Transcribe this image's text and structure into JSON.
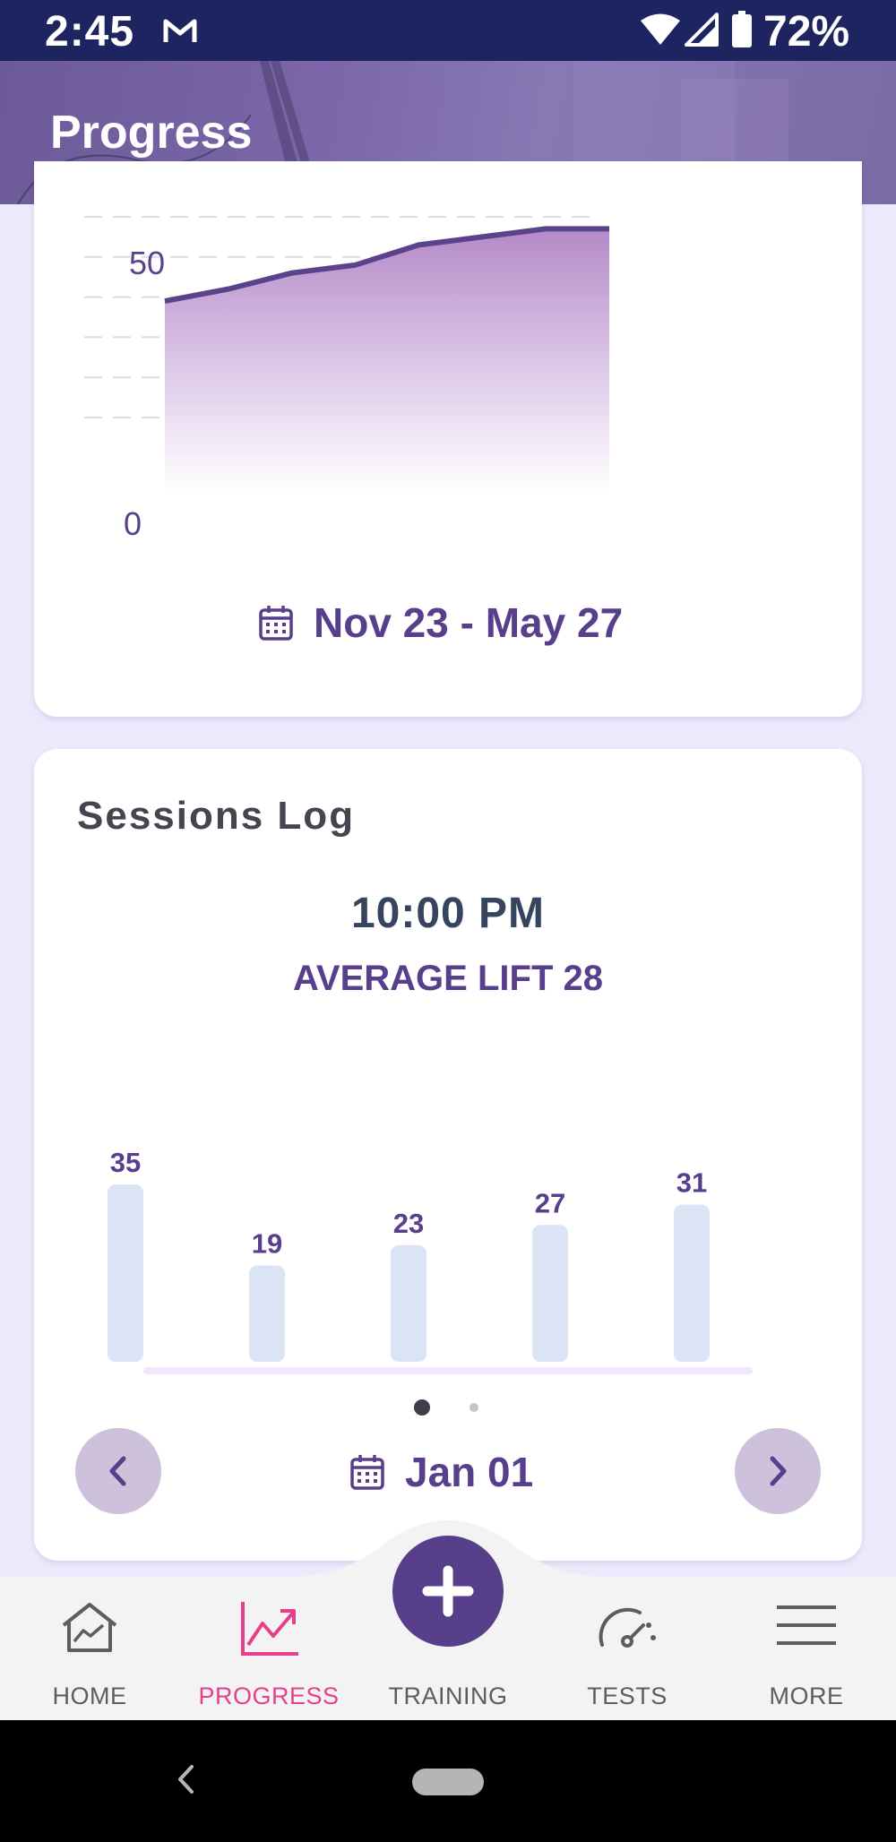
{
  "status_bar": {
    "time": "2:45",
    "battery": "72%"
  },
  "header": {
    "title": "Progress"
  },
  "progress_chart": {
    "date_range": "Nov 23 - May 27",
    "y_labels": [
      "50",
      "0"
    ]
  },
  "chart_data": [
    {
      "type": "area",
      "title": "",
      "ylabel": "",
      "ylim": [
        0,
        50
      ],
      "x": [
        "Nov 23",
        "",
        "",
        "",
        "",
        "",
        "",
        "May 27"
      ],
      "series": [
        {
          "values": [
            29,
            32,
            36,
            38,
            43,
            45,
            47,
            47
          ]
        }
      ],
      "grid": true,
      "color": "#5a438a"
    },
    {
      "type": "bar",
      "title": "",
      "categories": [
        "",
        "",
        "",
        "",
        ""
      ],
      "values": [
        35,
        19,
        23,
        27,
        31
      ],
      "grid": false,
      "color": "#dbe4f5"
    }
  ],
  "sessions": {
    "title": "Sessions Log",
    "time": "10:00 PM",
    "average": "AVERAGE LIFT 28",
    "date": "Jan 01",
    "bar_labels": [
      "35",
      "19",
      "23",
      "27",
      "31"
    ]
  },
  "bottom_nav": {
    "home": "HOME",
    "progress": "PROGRESS",
    "training": "TRAINING",
    "tests": "TESTS",
    "more": "MORE"
  },
  "colors": {
    "primary": "#583f8c",
    "accent_pink": "#e83e8c",
    "status_bar": "#1e2460",
    "background": "#ebe9fb"
  }
}
